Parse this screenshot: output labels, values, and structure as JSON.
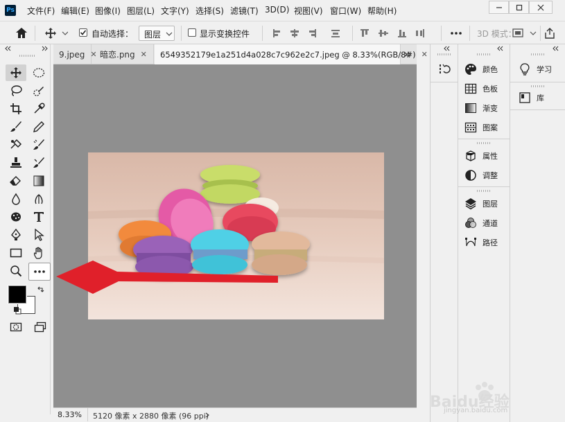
{
  "app": {
    "logo_text": "Ps"
  },
  "menu": [
    "文件(F)",
    "编辑(E)",
    "图像(I)",
    "图层(L)",
    "文字(Y)",
    "选择(S)",
    "滤镜(T)",
    "3D(D)",
    "视图(V)",
    "窗口(W)",
    "帮助(H)"
  ],
  "options": {
    "auto_select_label": "自动选择：",
    "auto_select_value": "图层",
    "transform_label": "显示变换控件",
    "mode_3d_label": "3D 模式："
  },
  "tabs": [
    {
      "label": "9.jpeg"
    },
    {
      "label": "暗恋.png"
    },
    {
      "label": "6549352179e1a251d4a028c7c962e2c7.jpeg @ 8.33%(RGB/8#)"
    }
  ],
  "status": {
    "zoom": "8.33%",
    "doc_info": "5120 像素 x 2880 像素 (96 ppi)"
  },
  "panels_mid": [
    {
      "label": "颜色",
      "icon": "palette-icon"
    },
    {
      "label": "色板",
      "icon": "swatches-grid-icon"
    },
    {
      "label": "渐变",
      "icon": "gradient-icon"
    },
    {
      "label": "图案",
      "icon": "pattern-icon"
    },
    {
      "label": "属性",
      "icon": "properties-icon"
    },
    {
      "label": "调整",
      "icon": "adjustments-icon"
    },
    {
      "label": "图层",
      "icon": "layers-icon"
    },
    {
      "label": "通道",
      "icon": "channels-icon"
    },
    {
      "label": "路径",
      "icon": "paths-icon"
    }
  ],
  "panels_right": [
    {
      "label": "学习",
      "icon": "lightbulb-icon"
    },
    {
      "label": "库",
      "icon": "library-icon"
    }
  ],
  "watermark": {
    "text": "Baidu经验",
    "url": "jingyan.baidu.com"
  },
  "colors": {
    "arrow": "#e0202a",
    "canvas_bg": "#8f8f8f",
    "foreground": "#000000",
    "background": "#ffffff"
  }
}
